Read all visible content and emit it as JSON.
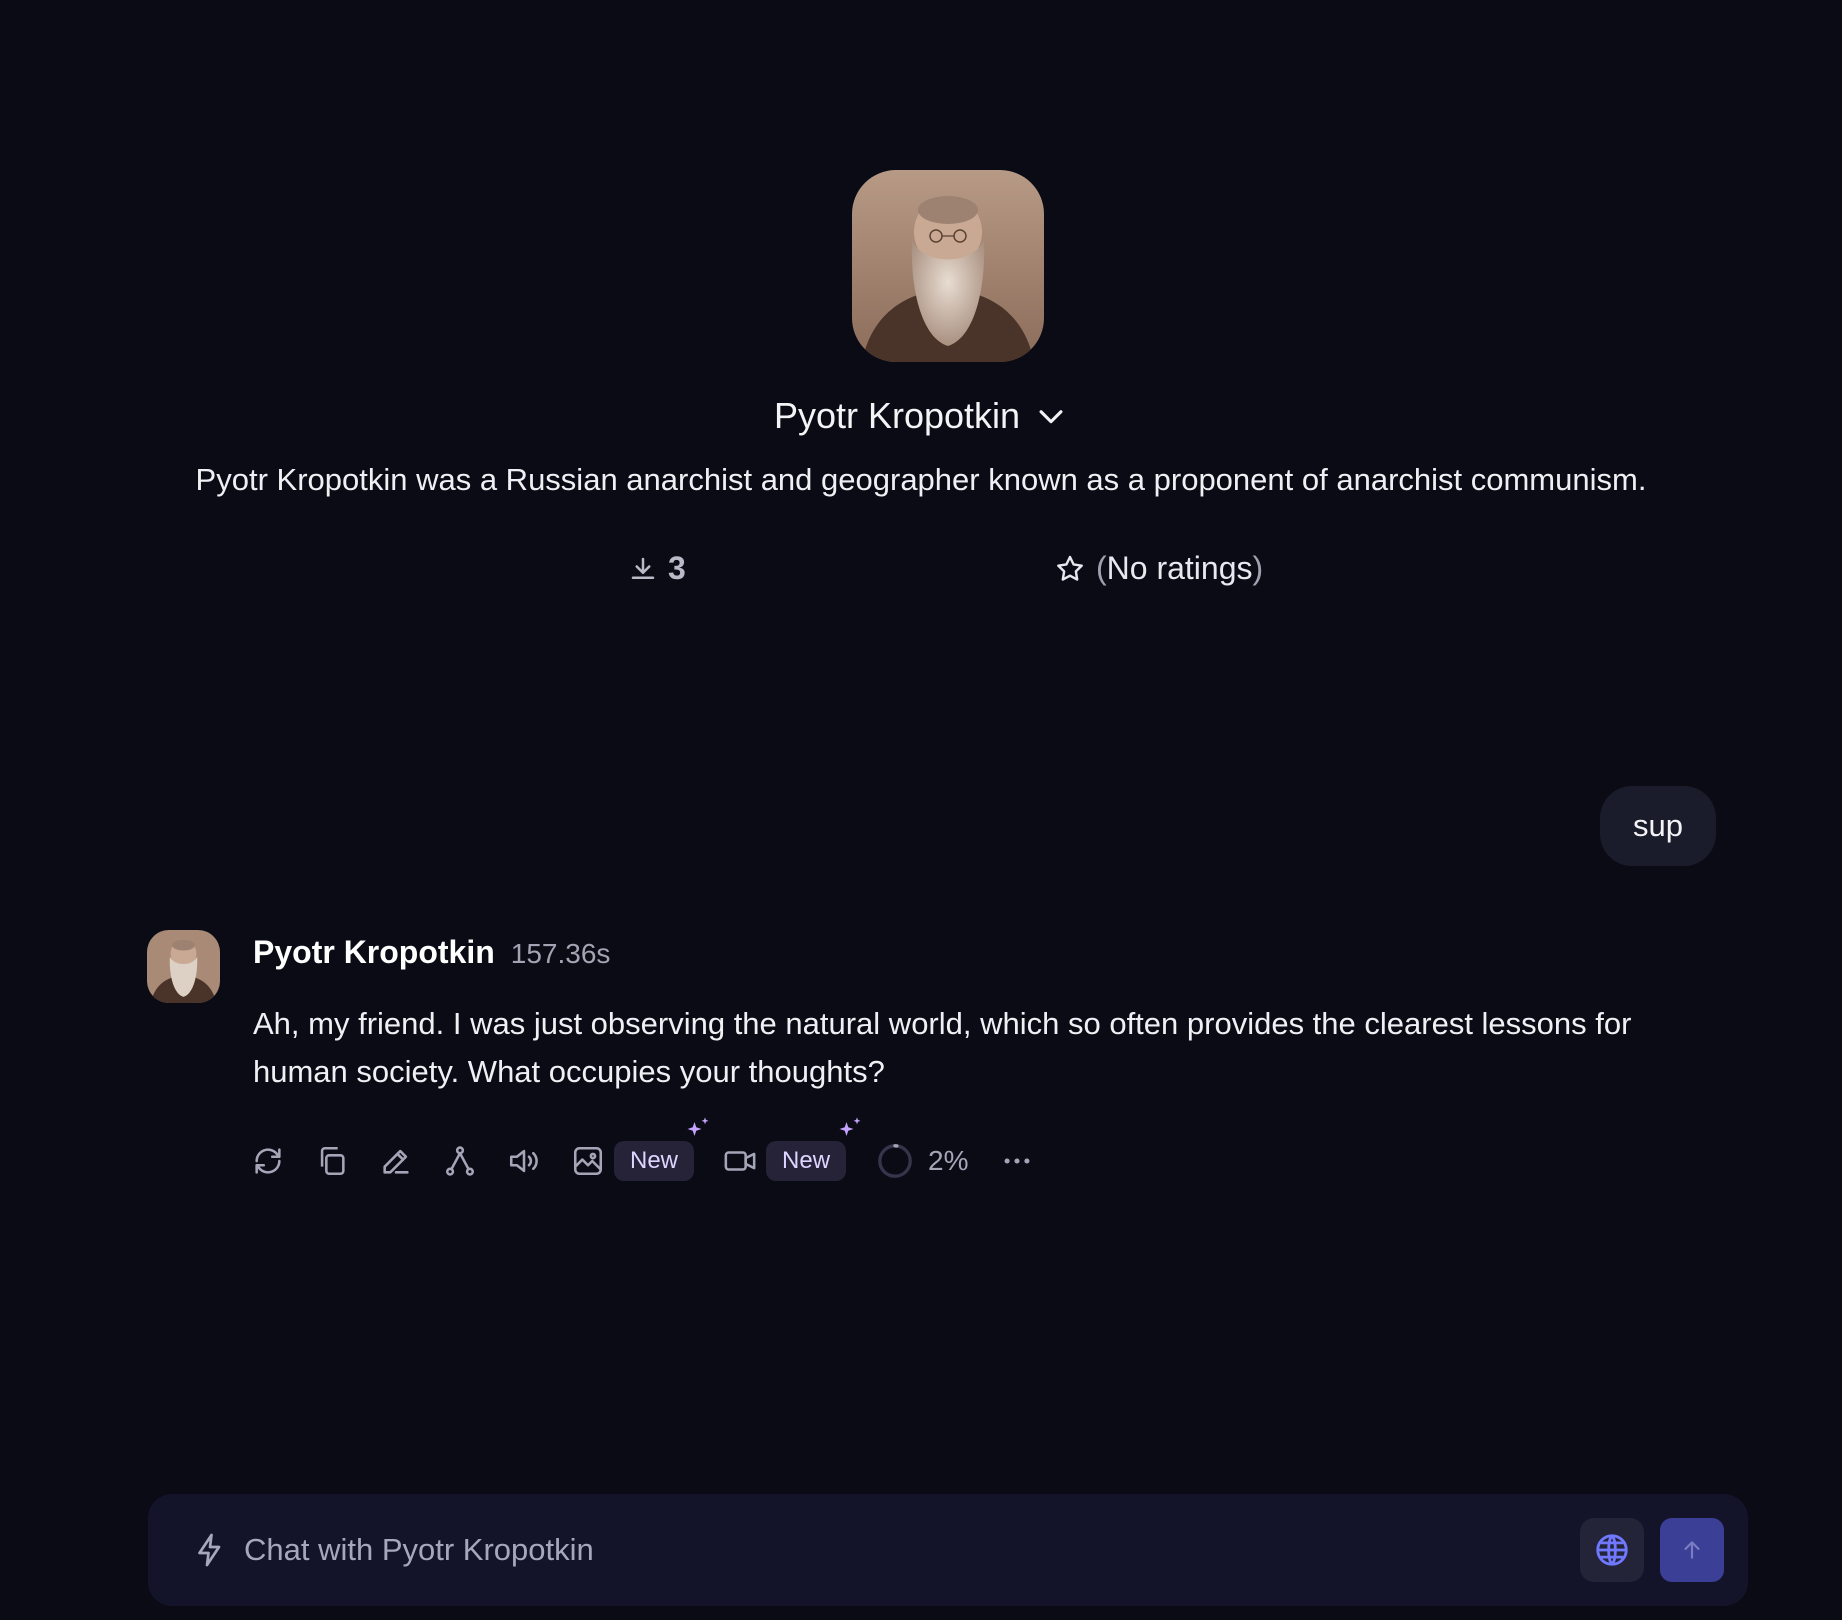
{
  "character": {
    "name": "Pyotr Kropotkin",
    "description": "Pyotr Kropotkin was a Russian anarchist and geographer known as a proponent of anarchist communism.",
    "downloads": "3",
    "rating_open": "(",
    "rating_text": "No ratings",
    "rating_close": ")",
    "avatar_icon": "portrait-image"
  },
  "conversation": {
    "user_message": "sup",
    "bot": {
      "author": "Pyotr Kropotkin",
      "elapsed": "157.36s",
      "text": "Ah, my friend. I was just observing the natural world, which so often provides the clearest lessons for human society. What occupies your thoughts?"
    }
  },
  "toolbar": {
    "icons": [
      "regenerate-icon",
      "copy-icon",
      "edit-icon",
      "branch-icon",
      "speaker-icon",
      "image-icon",
      "video-icon",
      "more-icon"
    ],
    "image_badge": "New",
    "video_badge": "New",
    "progress_label": "2%",
    "progress_value": 0.02
  },
  "input": {
    "placeholder": "Chat with Pyotr Kropotkin"
  },
  "colors": {
    "background": "#0a0b15",
    "bubble": "#1b1c2b",
    "input_bg": "#13142a",
    "send_button": "#3c3f96",
    "globe_icon": "#6f78ff",
    "badge_bg": "#262338",
    "sparkle": "#c6a3ff"
  }
}
